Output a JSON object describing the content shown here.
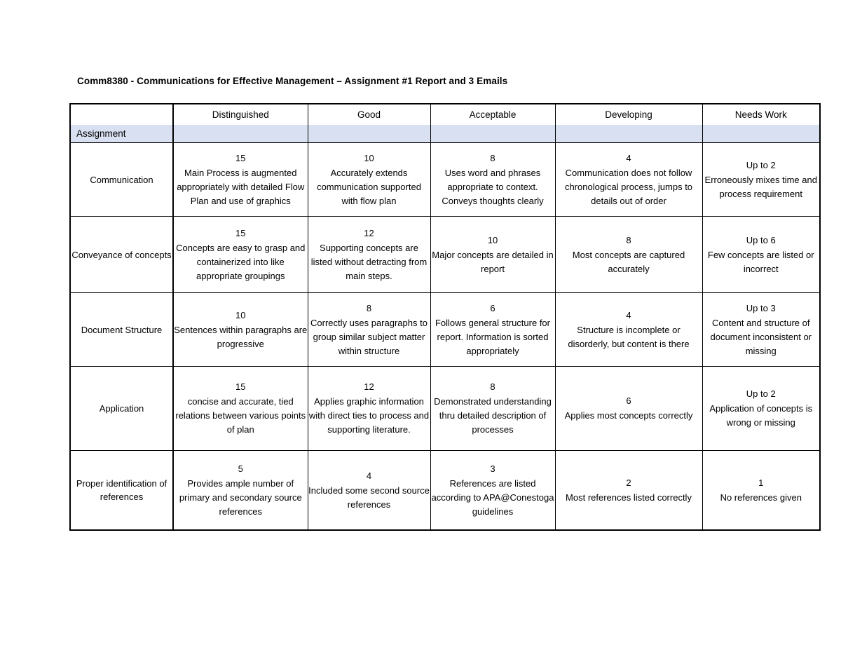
{
  "document": {
    "title": "Comm8380 - Communications for Effective Management – Assignment #1 Report and 3 Emails"
  },
  "table": {
    "row_header_label": "Assignment",
    "columns": [
      {
        "label": "Distinguished"
      },
      {
        "label": "Good"
      },
      {
        "label": "Acceptable"
      },
      {
        "label": "Developing"
      },
      {
        "label": "Needs Work"
      }
    ],
    "shade_color": "#d9e0f1",
    "rows": [
      {
        "criterion": "Communication",
        "cells": [
          {
            "score": "15",
            "desc": "Main Process is augmented appropriately with detailed Flow Plan and use of graphics"
          },
          {
            "score": "10",
            "desc": "Accurately extends communication supported with flow plan"
          },
          {
            "score": "8",
            "desc": "Uses word and phrases appropriate to context. Conveys thoughts clearly"
          },
          {
            "score": "4",
            "desc": "Communication does not follow chronological process, jumps to details out of order"
          },
          {
            "score": "Up to 2",
            "desc": "Erroneously mixes time and process requirement"
          }
        ]
      },
      {
        "criterion": "Conveyance of concepts",
        "cells": [
          {
            "score": "15",
            "desc": "Concepts are easy to grasp and containerized into like appropriate groupings"
          },
          {
            "score": "12",
            "desc": "Supporting concepts are listed without detracting from main steps."
          },
          {
            "score": "10",
            "desc": "Major concepts are detailed in report"
          },
          {
            "score": "8",
            "desc": "Most concepts are captured accurately"
          },
          {
            "score": "Up to 6",
            "desc": "Few concepts are listed or incorrect"
          }
        ]
      },
      {
        "criterion": "Document Structure",
        "cells": [
          {
            "score": "10",
            "desc": "Sentences within paragraphs are progressive"
          },
          {
            "score": "8",
            "desc": "Correctly uses paragraphs to group similar subject matter within structure"
          },
          {
            "score": "6",
            "desc": "Follows general structure for report. Information is sorted appropriately"
          },
          {
            "score": "4",
            "desc": "Structure is incomplete or disorderly, but content is there"
          },
          {
            "score": "Up to 3",
            "desc": "Content and structure of document inconsistent or missing"
          }
        ]
      },
      {
        "criterion": "Application",
        "cells": [
          {
            "score": "15",
            "desc": "concise and accurate, tied relations between various points of plan"
          },
          {
            "score": "12",
            "desc": "Applies graphic information with direct ties to process and supporting literature."
          },
          {
            "score": "8",
            "desc": "Demonstrated understanding thru detailed description of processes"
          },
          {
            "score": "6",
            "desc": "Applies most concepts correctly"
          },
          {
            "score": "Up to 2",
            "desc": "Application of concepts is wrong or missing"
          }
        ]
      },
      {
        "criterion": "Proper identification of references",
        "cells": [
          {
            "score": "5",
            "desc": "Provides ample number of primary and secondary source references"
          },
          {
            "score": "4",
            "desc": "Included some second source references"
          },
          {
            "score": "3",
            "desc": "References are listed according to APA@Conestoga guidelines"
          },
          {
            "score": "2",
            "desc": "Most references listed correctly"
          },
          {
            "score": "1",
            "desc": "No references given"
          }
        ]
      }
    ]
  }
}
